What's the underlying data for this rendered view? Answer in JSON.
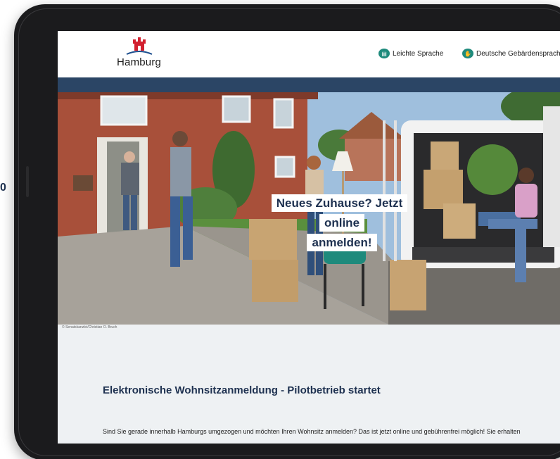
{
  "page_edge_char": "0",
  "header": {
    "logo_text": "Hamburg",
    "links": [
      {
        "label": "Leichte Sprache",
        "icon": "easy-language-icon"
      },
      {
        "label": "Deutsche Gebärdensprache",
        "icon": "sign-language-icon"
      }
    ]
  },
  "hero": {
    "caption_line1": "Neues Zuhause? Jetzt online",
    "caption_line2": "anmelden!",
    "credit": "© Senatskanzlei/Christian O. Bruch"
  },
  "article": {
    "title": "Elektronische Wohnsitzanmeldung - Pilotbetrieb startet",
    "text": "Sind Sie gerade innerhalb Hamburgs umgezogen und möchten Ihren Wohnsitz anmelden? Das ist jetzt online und gebührenfrei möglich! Sie erhalten"
  },
  "colors": {
    "nav_bar": "#2b4565",
    "title": "#1e3150",
    "icon_teal": "#1e8a7c",
    "logo_red": "#d2202f"
  }
}
